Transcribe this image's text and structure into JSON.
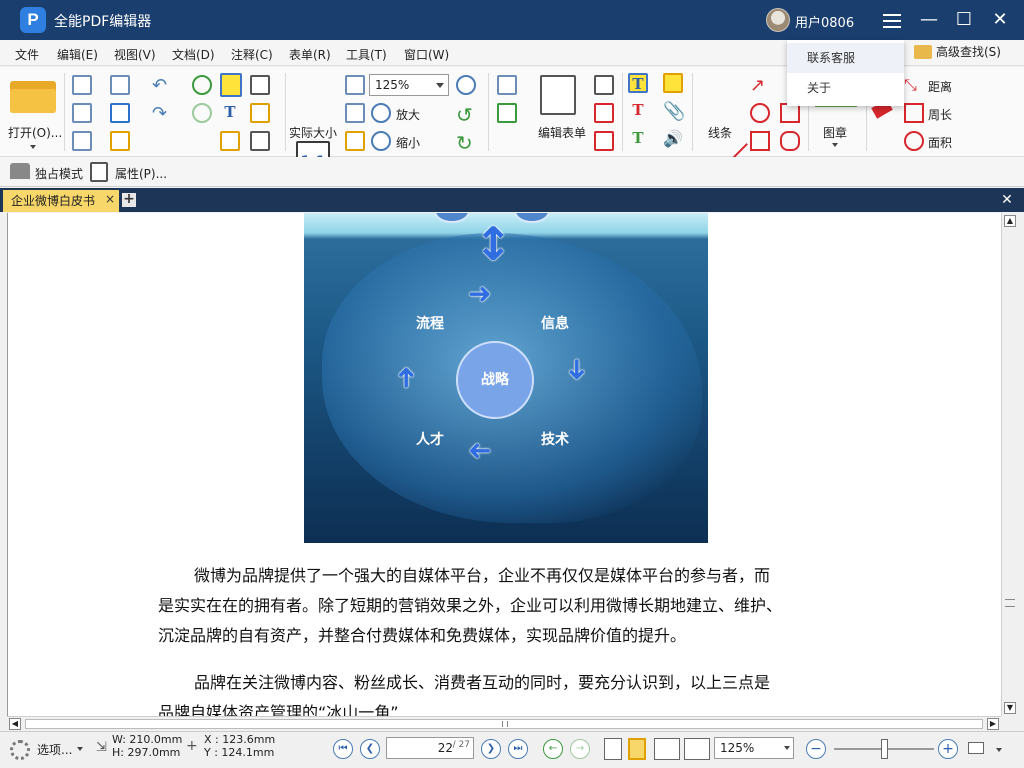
{
  "app": {
    "title": "全能PDF编辑器",
    "logo": "P",
    "user": "用户0806"
  },
  "dropdown": {
    "items": [
      "联系客服",
      "关于"
    ]
  },
  "menu": [
    "文件",
    "编辑(E)",
    "视图(V)",
    "文档(D)",
    "注释(C)",
    "表单(R)",
    "工具(T)",
    "窗口(W)"
  ],
  "menu_right": {
    "advanced_search": "高级查找(S)"
  },
  "toolbar": {
    "open": "打开(O)...",
    "zoom_value": "125%",
    "zoom_in": "放大",
    "zoom_out": "缩小",
    "actual_size": "实际大小",
    "actual_size_icon": "1:1",
    "edit_form": "编辑表单",
    "line": "线条",
    "stamp": "图章",
    "distance": "距离",
    "perimeter": "周长",
    "area": "面积",
    "exclusive_mode": "独占模式",
    "properties": "属性(P)..."
  },
  "tab": {
    "label": "企业微博白皮书"
  },
  "document": {
    "diagram": {
      "center": "战略",
      "top_left": "流程",
      "top_right": "信息",
      "bottom_left": "人才",
      "bottom_right": "技术"
    },
    "para1": "微博为品牌提供了一个强大的自媒体平台，企业不再仅仅是媒体平台的参与者，而是实实在在的拥有者。除了短期的营销效果之外，企业可以利用微博长期地建立、维护、沉淀品牌的自有资产，并整合付费媒体和免费媒体，实现品牌价值的提升。",
    "para1_line1": "微博为品牌提供了一个强大的自媒体平台，企业不再仅仅是媒体平台的参与者，而",
    "para1_line2": "是实实在在的拥有者。除了短期的营销效果之外，企业可以利用微博长期地建立、维护、",
    "para1_line3": "沉淀品牌的自有资产，并整合付费媒体和免费媒体，实现品牌价值的提升。",
    "para2_line1": "品牌在关注微博内容、粉丝成长、消费者互动的同时，要充分认识到，以上三点是",
    "para2_line2": "品牌自媒体资产管理的“冰山一角”"
  },
  "status": {
    "options": "选项...",
    "width": "W: 210.0mm",
    "height": "H: 297.0mm",
    "x": "X : 123.6mm",
    "y": "Y : 124.1mm",
    "page_current": "22",
    "page_total": "/ 27",
    "zoom": "125%"
  },
  "colors": {
    "titlebar": "#1a3e6e",
    "tab_active": "#f7d66a",
    "tabbar": "#1d3557"
  }
}
